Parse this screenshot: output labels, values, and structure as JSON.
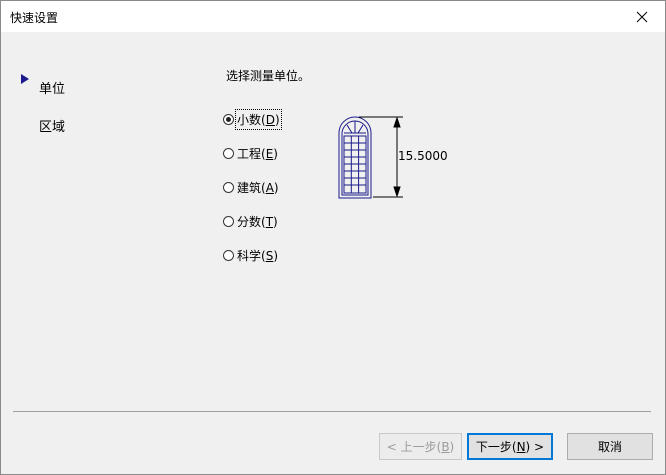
{
  "window": {
    "title": "快速设置"
  },
  "nav": {
    "items": [
      {
        "label": "单位",
        "selected": true
      },
      {
        "label": "区域",
        "selected": false
      }
    ]
  },
  "units": {
    "prompt": "选择测量单位。",
    "options": [
      {
        "text": "小数(",
        "key": "D",
        "tail": ")",
        "checked": true
      },
      {
        "text": "工程(",
        "key": "E",
        "tail": ")",
        "checked": false
      },
      {
        "text": "建筑(",
        "key": "A",
        "tail": ")",
        "checked": false
      },
      {
        "text": "分数(",
        "key": "T",
        "tail": ")",
        "checked": false
      },
      {
        "text": "科学(",
        "key": "S",
        "tail": ")",
        "checked": false
      }
    ],
    "preview_dimension": "15.5000"
  },
  "buttons": {
    "back": {
      "prefix": "< 上一步(",
      "key": "B",
      "suffix": ")",
      "enabled": false
    },
    "next": {
      "prefix": "下一步(",
      "key": "N",
      "suffix": ") >",
      "enabled": true
    },
    "cancel": {
      "label": "取消"
    }
  },
  "colors": {
    "accent": "#0078d7",
    "nav_marker": "#1a1a8c",
    "preview_stroke": "#1a1a8c"
  }
}
